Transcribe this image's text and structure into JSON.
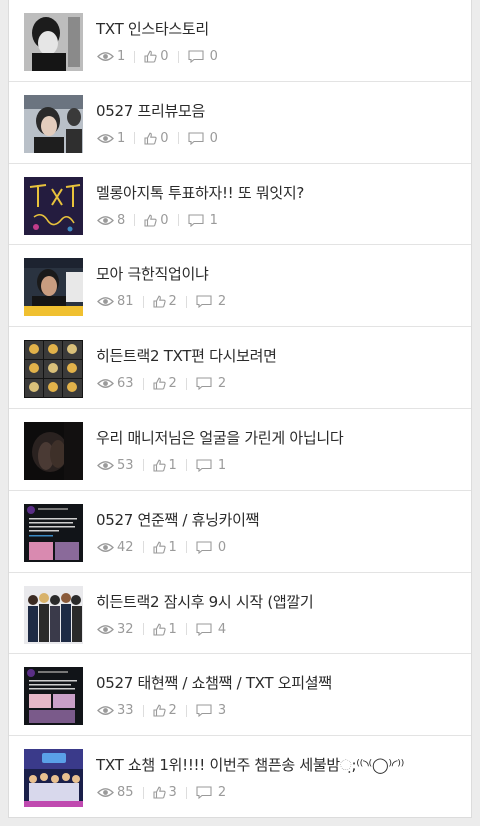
{
  "posts": [
    {
      "title": "TXT 인스타스토리",
      "views": "1",
      "likes": "0",
      "comments": "0",
      "thumb": "photo-bw-portrait"
    },
    {
      "title": "0527 프리뷰모음",
      "views": "1",
      "likes": "0",
      "comments": "0",
      "thumb": "photo-preview"
    },
    {
      "title": "멜롱아지톡 투표하자!! 또 뭐잇지?",
      "views": "8",
      "likes": "0",
      "comments": "1",
      "thumb": "drawing-dark"
    },
    {
      "title": "모아 극한직업이냐",
      "views": "81",
      "likes": "2",
      "comments": "2",
      "thumb": "tv-capture"
    },
    {
      "title": "히든트랙2 TXT편 다시보려면",
      "views": "63",
      "likes": "2",
      "comments": "2",
      "thumb": "grid-faces"
    },
    {
      "title": "우리 매니저님은 얼굴을 가린게 아닙니다",
      "views": "53",
      "likes": "1",
      "comments": "1",
      "thumb": "dark-hands"
    },
    {
      "title": "0527 연준짹 / 휴닝카이짹",
      "views": "42",
      "likes": "1",
      "comments": "0",
      "thumb": "tweet-dark"
    },
    {
      "title": "히든트랙2 잠시후 9시 시작 (앱깔기",
      "views": "32",
      "likes": "1",
      "comments": "4",
      "thumb": "group-photo"
    },
    {
      "title": "0527 태현짹 / 쇼챔짹 / TXT 오피셜짹",
      "views": "33",
      "likes": "2",
      "comments": "3",
      "thumb": "tweet-dark-2"
    },
    {
      "title": "TXT 쇼챔 1위!!!! 이번주 챔픈송 세불밤ᨘ;⁽⁽◝⁽◯⁾◜⁾⁾",
      "views": "85",
      "likes": "3",
      "comments": "2",
      "thumb": "stage-show"
    }
  ],
  "colors": {
    "text": "#2b2b2b",
    "meta": "#9a9a9a",
    "divider": "#e3e3e3"
  },
  "icons": {
    "views": "eye-icon",
    "likes": "thumbs-up-icon",
    "comments": "comment-icon"
  }
}
